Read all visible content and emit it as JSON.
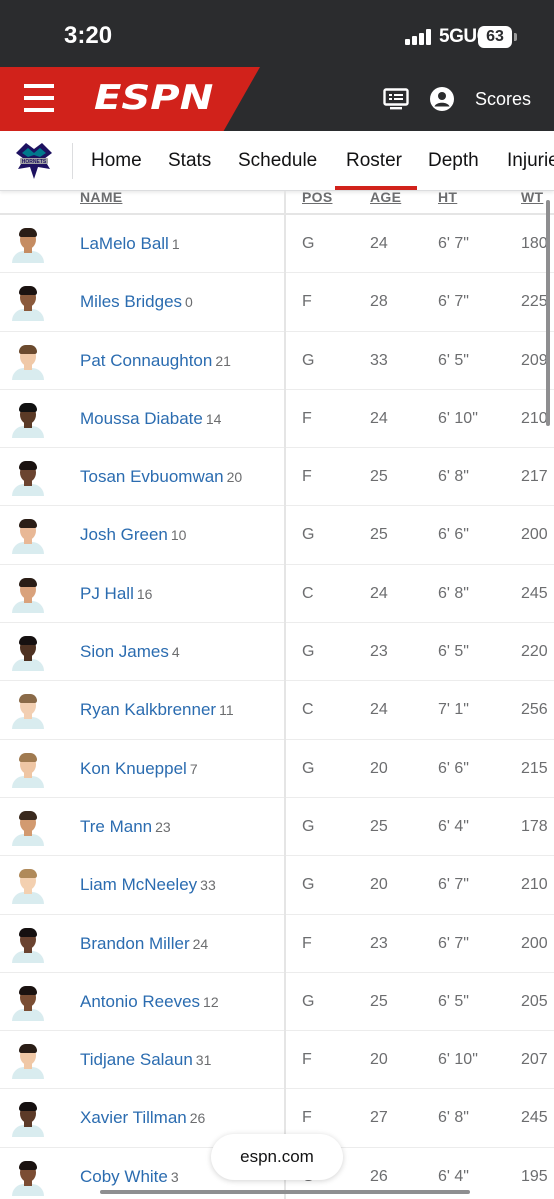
{
  "status": {
    "time": "3:20",
    "network": "5GUC",
    "battery": "63"
  },
  "header": {
    "logo": "ESPN",
    "scores_label": "Scores",
    "brand_color": "#d1221b"
  },
  "team_nav": {
    "items": [
      "Home",
      "Stats",
      "Schedule",
      "Roster",
      "Depth",
      "Injuries"
    ],
    "active": "Roster"
  },
  "table": {
    "headers": {
      "name": "NAME",
      "pos": "POS",
      "age": "AGE",
      "ht": "HT",
      "wt": "WT"
    },
    "players": [
      {
        "name": "LaMelo Ball",
        "num": "1",
        "pos": "G",
        "age": "24",
        "ht": "6' 7\"",
        "wt": "180"
      },
      {
        "name": "Miles Bridges",
        "num": "0",
        "pos": "F",
        "age": "28",
        "ht": "6' 7\"",
        "wt": "225"
      },
      {
        "name": "Pat Connaughton",
        "num": "21",
        "pos": "G",
        "age": "33",
        "ht": "6' 5\"",
        "wt": "209"
      },
      {
        "name": "Moussa Diabate",
        "num": "14",
        "pos": "F",
        "age": "24",
        "ht": "6' 10\"",
        "wt": "210"
      },
      {
        "name": "Tosan Evbuomwan",
        "num": "20",
        "pos": "F",
        "age": "25",
        "ht": "6' 8\"",
        "wt": "217"
      },
      {
        "name": "Josh Green",
        "num": "10",
        "pos": "G",
        "age": "25",
        "ht": "6' 6\"",
        "wt": "200"
      },
      {
        "name": "PJ Hall",
        "num": "16",
        "pos": "C",
        "age": "24",
        "ht": "6' 8\"",
        "wt": "245"
      },
      {
        "name": "Sion James",
        "num": "4",
        "pos": "G",
        "age": "23",
        "ht": "6' 5\"",
        "wt": "220"
      },
      {
        "name": "Ryan Kalkbrenner",
        "num": "11",
        "pos": "C",
        "age": "24",
        "ht": "7' 1\"",
        "wt": "256"
      },
      {
        "name": "Kon Knueppel",
        "num": "7",
        "pos": "G",
        "age": "20",
        "ht": "6' 6\"",
        "wt": "215"
      },
      {
        "name": "Tre Mann",
        "num": "23",
        "pos": "G",
        "age": "25",
        "ht": "6' 4\"",
        "wt": "178"
      },
      {
        "name": "Liam McNeeley",
        "num": "33",
        "pos": "G",
        "age": "20",
        "ht": "6' 7\"",
        "wt": "210"
      },
      {
        "name": "Brandon Miller",
        "num": "24",
        "pos": "F",
        "age": "23",
        "ht": "6' 7\"",
        "wt": "200"
      },
      {
        "name": "Antonio Reeves",
        "num": "12",
        "pos": "G",
        "age": "25",
        "ht": "6' 5\"",
        "wt": "205"
      },
      {
        "name": "Tidjane Salaun",
        "num": "31",
        "pos": "F",
        "age": "20",
        "ht": "6' 10\"",
        "wt": "207"
      },
      {
        "name": "Xavier Tillman",
        "num": "26",
        "pos": "F",
        "age": "27",
        "ht": "6' 8\"",
        "wt": "245"
      },
      {
        "name": "Coby White",
        "num": "3",
        "pos": "G",
        "age": "26",
        "ht": "6' 4\"",
        "wt": "195"
      }
    ]
  },
  "browser": {
    "url": "espn.com"
  }
}
